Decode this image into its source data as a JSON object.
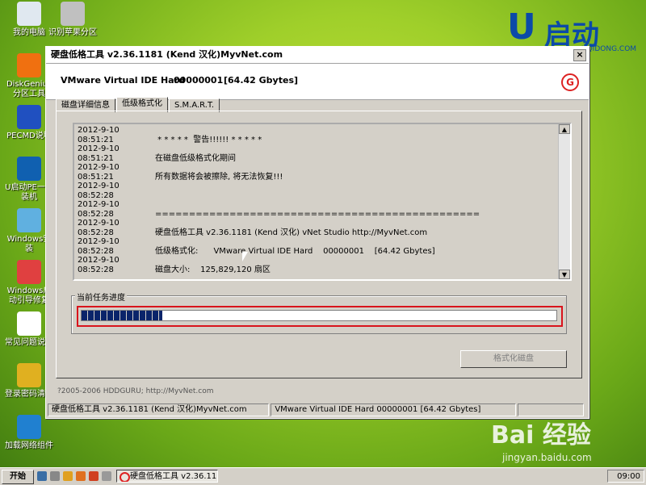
{
  "desktop_icons": [
    {
      "label": "我的电脑",
      "icon": "computer-icon",
      "color": "#e0e8f0"
    },
    {
      "label": "识别苹果分区",
      "icon": "disk-icon",
      "color": "#c0c0c0"
    },
    {
      "label": "DiskGenius分区工具",
      "icon": "diskgenius-icon",
      "color": "#f07010"
    },
    {
      "label": "PECMD说明",
      "icon": "help-icon",
      "color": "#2050c0"
    },
    {
      "label": "U启动PE一键装机",
      "icon": "uqidong-icon",
      "color": "#1060b0"
    },
    {
      "label": "Windows安装",
      "icon": "windows-icon",
      "color": "#60b0e0"
    },
    {
      "label": "Windows启动引导修复",
      "icon": "toolbox-icon",
      "color": "#e04040"
    },
    {
      "label": "常见问题说明",
      "icon": "document-icon",
      "color": "#ffffff"
    },
    {
      "label": "登录密码清除",
      "icon": "key-icon",
      "color": "#e0b020"
    },
    {
      "label": "加载网络组件",
      "icon": "network-icon",
      "color": "#2080d0"
    }
  ],
  "brand": {
    "logo_text": "启动",
    "logo_letter": "U",
    "url": "UQIDONG.COM"
  },
  "window": {
    "title": "硬盘低格工具 v2.36.1181 (Kend 汉化)MyvNet.com",
    "close": "×",
    "device": "VMware Virtual IDE Hard",
    "serial": "00000001",
    "size": "[64.42 Gbytes]",
    "tabs": [
      {
        "label": "磁盘详细信息",
        "active": false
      },
      {
        "label": "低级格式化",
        "active": true
      },
      {
        "label": "S.M.A.R.T.",
        "active": false
      }
    ],
    "log": [
      {
        "ts": "2012-9-10 08:51:21",
        "msg": " * * * * *  警告!!!!!! * * * * *"
      },
      {
        "ts": "2012-9-10 08:51:21",
        "msg": "在磁盘低级格式化期间"
      },
      {
        "ts": "2012-9-10 08:51:21",
        "msg": "所有数据将会被擦除, 将无法恢复!!!"
      },
      {
        "ts": "2012-9-10 08:52:28",
        "msg": ""
      },
      {
        "ts": "2012-9-10 08:52:28",
        "msg": "================================================"
      },
      {
        "ts": "2012-9-10 08:52:28",
        "msg": "硬盘低格工具 v2.36.1181 (Kend 汉化) vNet Studio http://MyvNet.com"
      },
      {
        "ts": "2012-9-10 08:52:28",
        "msg": "低级格式化:      VMware Virtual IDE Hard    00000001    [64.42 Gbytes]"
      },
      {
        "ts": "2012-9-10 08:52:28",
        "msg": "磁盘大小:    125,829,120 扇区"
      }
    ],
    "progress_label": "当前任务进度",
    "progress_fraction": 0.17,
    "format_button": "格式化磁盘",
    "copyright": "?2005-2006 HDDGURU;   http://MyvNet.com",
    "status": [
      "硬盘低格工具 v2.36.1181 (Kend 汉化)MyvNet.com",
      "VMware Virtual IDE Hard      00000001      [64.42 Gbytes]",
      ""
    ]
  },
  "taskbar": {
    "start": "开始",
    "task": "硬盘低格工具 v2.36.11...",
    "clock": "09:00"
  },
  "watermark": {
    "main": "Bai 经验",
    "sub": "jingyan.baidu.com"
  }
}
